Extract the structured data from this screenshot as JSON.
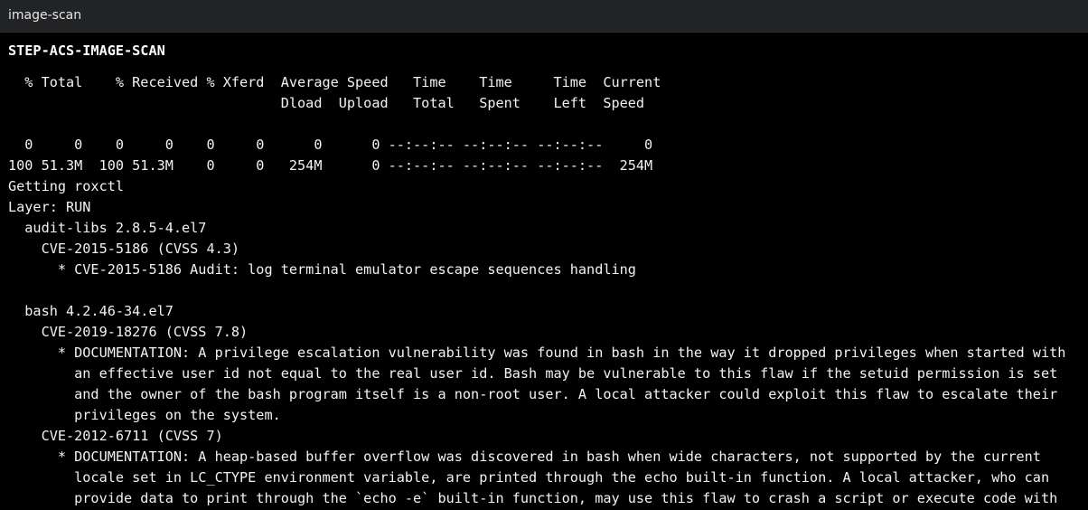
{
  "window": {
    "title": "image-scan"
  },
  "step": {
    "heading": "STEP-ACS-IMAGE-SCAN"
  },
  "log": {
    "lines": [
      "  % Total    % Received % Xferd  Average Speed   Time    Time     Time  Current",
      "                                 Dload  Upload   Total   Spent    Left  Speed",
      "",
      "  0     0    0     0    0     0      0      0 --:--:-- --:--:-- --:--:--     0",
      "100 51.3M  100 51.3M    0     0   254M      0 --:--:-- --:--:-- --:--:--  254M",
      "Getting roxctl",
      "Layer: RUN",
      "  audit-libs 2.8.5-4.el7",
      "    CVE-2015-5186 (CVSS 4.3)",
      "      * CVE-2015-5186 Audit: log terminal emulator escape sequences handling",
      "",
      "  bash 4.2.46-34.el7",
      "    CVE-2019-18276 (CVSS 7.8)",
      "      * DOCUMENTATION: A privilege escalation vulnerability was found in bash in the way it dropped privileges when started with",
      "        an effective user id not equal to the real user id. Bash may be vulnerable to this flaw if the setuid permission is set",
      "        and the owner of the bash program itself is a non-root user. A local attacker could exploit this flaw to escalate their",
      "        privileges on the system.",
      "    CVE-2012-6711 (CVSS 7)",
      "      * DOCUMENTATION: A heap-based buffer overflow was discovered in bash when wide characters, not supported by the current",
      "        locale set in LC_CTYPE environment variable, are printed through the echo built-in function. A local attacker, who can",
      "        provide data to print through the `echo -e` built-in function, may use this flaw to crash a script or execute code with"
    ]
  }
}
